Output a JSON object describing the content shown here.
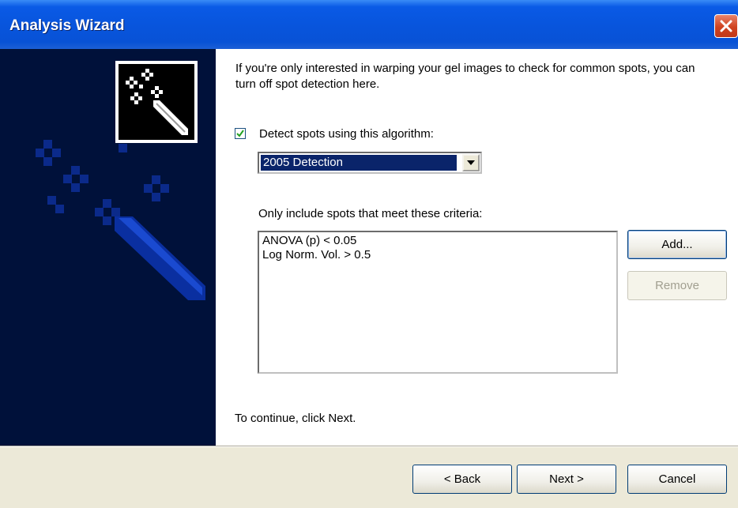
{
  "window": {
    "title": "Analysis Wizard"
  },
  "intro_text": "If you're only interested in warping your gel images to check for common spots, you can turn off spot detection here.",
  "detect": {
    "checked": true,
    "label": "Detect spots using this algorithm:"
  },
  "algorithm": {
    "selected": "2005 Detection"
  },
  "criteria": {
    "label": "Only include spots that meet these criteria:",
    "items": [
      "ANOVA (p) < 0.05",
      "Log Norm. Vol. > 0.5"
    ],
    "add_label": "Add...",
    "remove_label": "Remove"
  },
  "footer_text": "To continue, click Next.",
  "nav": {
    "back_label": "< Back",
    "next_label": "Next >",
    "cancel_label": "Cancel"
  },
  "icons": {
    "close": "close-icon",
    "wand": "magic-wand-icon",
    "dropdown": "chevron-down-icon",
    "check": "check-icon"
  },
  "colors": {
    "titlebar": "#0855dd",
    "sidepanel": "#00113a",
    "selection": "#0a246a",
    "close": "#d0421f"
  }
}
